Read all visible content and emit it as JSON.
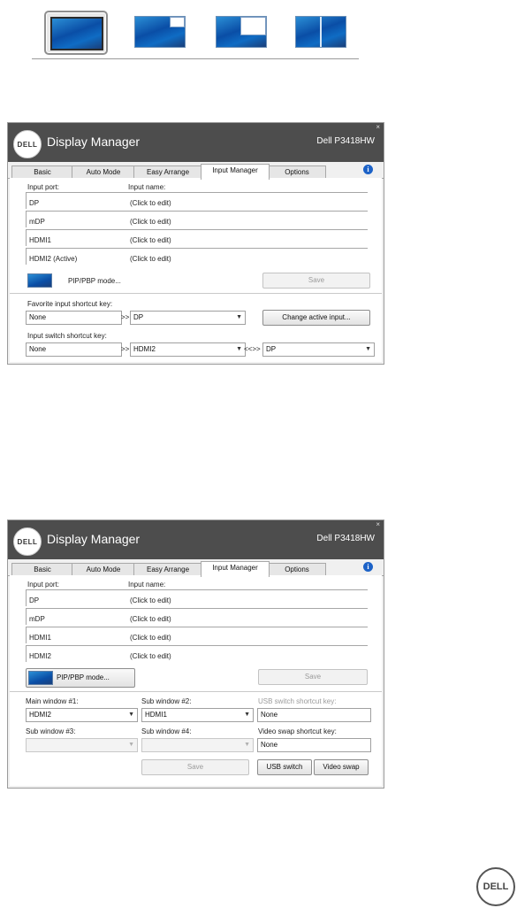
{
  "mode_strip": {
    "modes": [
      "Single window",
      "PIP mode",
      "PIP mode",
      "PBP mode"
    ]
  },
  "window1": {
    "app_title": "Display Manager",
    "model": "Dell P3418HW",
    "close": "×",
    "logo": "DELL",
    "info": "i",
    "tabs": [
      "Basic",
      "Auto Mode",
      "Easy Arrange",
      "Input Manager",
      "Options"
    ],
    "active_tab": "Input Manager",
    "col_port": "Input port:",
    "col_name": "Input name:",
    "rows": [
      {
        "port": "DP",
        "name": "(Click to edit)"
      },
      {
        "port": "mDP",
        "name": "(Click to edit)"
      },
      {
        "port": "HDMI1",
        "name": "(Click to edit)"
      },
      {
        "port": "HDMI2 (Active)",
        "name": "(Click to edit)"
      }
    ],
    "pip_mode_label": "PIP/PBP mode...",
    "save_label": "Save",
    "fav_label": "Favorite input shortcut key:",
    "fav_key": "None",
    "fav_arrow": ">>",
    "fav_select": "DP",
    "change_active_label": "Change active input...",
    "switch_label": "Input switch shortcut key:",
    "switch_key": "None",
    "switch_arrow": ">>",
    "switch_select_a": "HDMI2",
    "switch_swap": "<<>>",
    "switch_select_b": "DP"
  },
  "window2": {
    "app_title": "Display Manager",
    "model": "Dell P3418HW",
    "close": "×",
    "logo": "DELL",
    "info": "i",
    "tabs": [
      "Basic",
      "Auto Mode",
      "Easy Arrange",
      "Input Manager",
      "Options"
    ],
    "active_tab": "Input Manager",
    "col_port": "Input port:",
    "col_name": "Input name:",
    "rows": [
      {
        "port": "DP",
        "name": "(Click to edit)"
      },
      {
        "port": "mDP",
        "name": "(Click to edit)"
      },
      {
        "port": "HDMI1",
        "name": "(Click to edit)"
      },
      {
        "port": "HDMI2",
        "name": "(Click to edit)"
      }
    ],
    "pip_mode_label": "PIP/PBP mode...",
    "save_label": "Save",
    "main1_label": "Main window #1:",
    "main1_value": "HDMI2",
    "sub2_label": "Sub window #2:",
    "sub2_value": "HDMI1",
    "usb_label": "USB switch shortcut key:",
    "usb_value": "None",
    "sub3_label": "Sub window #3:",
    "sub4_label": "Sub window #4:",
    "swap_label": "Video swap shortcut key:",
    "swap_value": "None",
    "save2_label": "Save",
    "usb_btn": "USB switch",
    "swap_btn": "Video swap"
  },
  "footer_logo": "DELL"
}
